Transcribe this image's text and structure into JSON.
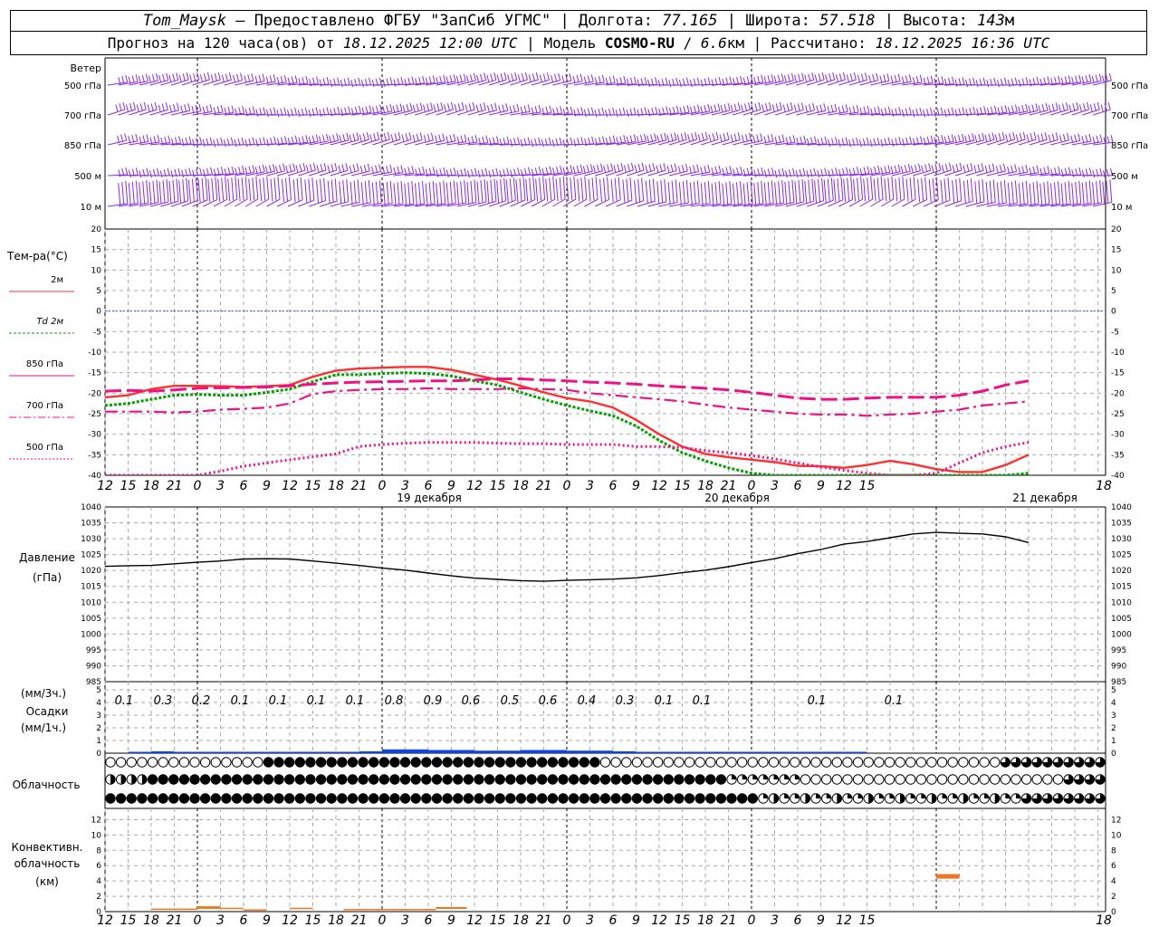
{
  "header": {
    "station": "Tom_Maysk",
    "provider": "– Предоставлено ФГБУ \"ЗапСиб УГМС\"",
    "lon_label": "Долгота:",
    "lon_value": "77.165",
    "lat_label": "Широта:",
    "lat_value": "57.518",
    "alt_label": "Высота:",
    "alt_value": "143",
    "alt_unit": "м",
    "forecast_prefix": "Прогноз на 120 часа(ов) от",
    "forecast_time": "18.12.2025 12:00 UTC",
    "model_label": "Модель",
    "model_name": "COSMO-RU",
    "model_res": "6.6",
    "model_res_unit": "км",
    "calc_label": "Рассчитано:",
    "calc_time": "18.12.2025 16:36 UTC"
  },
  "colors": {
    "wind": "#8a2be2",
    "t2m": "#ff3030",
    "td2m": "#00a000",
    "t850": "#ee1188",
    "zero_line": "#3355ff",
    "pressure": "#000000",
    "precip_bar": "#1144dd",
    "convective": "#ee7722",
    "grid": "#aaaaaa"
  },
  "wind_panel": {
    "title": "Ветер",
    "levels": [
      "500 гПа",
      "700 гПа",
      "850 гПа",
      "500 м",
      "10 м"
    ]
  },
  "temp_panel": {
    "title": "Тем-ра(°C)",
    "legend": [
      {
        "label": "2м",
        "key": "t2m"
      },
      {
        "label": "Td 2м",
        "key": "td2m"
      },
      {
        "label": "850 гПа",
        "key": "t850"
      },
      {
        "label": "700 гПа",
        "key": "t700"
      },
      {
        "label": "500 гПа",
        "key": "t500"
      }
    ],
    "ticks": [
      "20",
      "15",
      "10",
      "5",
      "0",
      "-5",
      "-10",
      "-15",
      "-20",
      "-25",
      "-30",
      "-35",
      "-40"
    ]
  },
  "time_axis": {
    "hour_labels": [
      "12",
      "15",
      "18",
      "21",
      "0",
      "3",
      "6",
      "9",
      "12",
      "15",
      "18",
      "21",
      "0",
      "3",
      "6",
      "9",
      "12",
      "15",
      "18",
      "21",
      "0",
      "3",
      "6",
      "9",
      "12",
      "15",
      "18",
      "21",
      "0",
      "3",
      "6",
      "9",
      "12",
      "15",
      "18"
    ],
    "day_labels": [
      "19 декабря",
      "20 декабря",
      "21 декабря"
    ]
  },
  "pressure_panel": {
    "title": "Давление",
    "unit": "(гПа)",
    "ticks": [
      "1040",
      "1035",
      "1030",
      "1025",
      "1020",
      "1015",
      "1010",
      "1005",
      "1000",
      "995",
      "990",
      "985"
    ]
  },
  "precip_panel": {
    "unit3": "(мм/3ч.)",
    "title": "Осадки",
    "unit1": "(мм/1ч.)",
    "ticks": [
      "5",
      "4",
      "3",
      "2",
      "1",
      "0"
    ],
    "labels": [
      "0.1",
      "0.3",
      "0.2",
      "0.1",
      "0.1",
      "0.1",
      "0.1",
      "0.8",
      "0.9",
      "0.6",
      "0.5",
      "0.6",
      "0.4",
      "0.3",
      "0.1",
      "0.1",
      "0.1",
      "0.1"
    ]
  },
  "cloud_panel": {
    "title": "Облачность"
  },
  "conv_panel": {
    "title_1": "Конвективн.",
    "title_2": "облачность",
    "unit": "(км)",
    "ticks": [
      "12",
      "10",
      "8",
      "6",
      "4",
      "2",
      "0"
    ]
  },
  "chart_data": [
    {
      "type": "line",
      "title": "Тем-ра(°C)",
      "x_hours": [
        0,
        3,
        6,
        9,
        12,
        15,
        18,
        21,
        24,
        27,
        30,
        33,
        36,
        39,
        42,
        45,
        48,
        51,
        54,
        57,
        60,
        63,
        66,
        69,
        72,
        75,
        78,
        81,
        84,
        87,
        90,
        93,
        96,
        99,
        102,
        105,
        108,
        111,
        114,
        117,
        120
      ],
      "ylim": [
        -40,
        20
      ],
      "series": [
        {
          "name": "2м",
          "values": [
            -21,
            -20.5,
            -19,
            -18.2,
            -18.2,
            -18.3,
            -18.5,
            -18.3,
            -18,
            -16,
            -14.5,
            -14,
            -13.8,
            -13.6,
            -13.6,
            -14.3,
            -15.5,
            -16.7,
            -18.2,
            -19.8,
            -21.2,
            -22,
            -23.5,
            -26.5,
            -30,
            -33,
            -34.8,
            -35.6,
            -36.2,
            -36.8,
            -37.7,
            -37.8,
            -38.2,
            -37.5,
            -36.5,
            -37.3,
            -38.5,
            -39.2,
            -39.2,
            -37.5,
            -35
          ]
        },
        {
          "name": "Td 2м",
          "values": [
            -23,
            -22.5,
            -21.5,
            -20.5,
            -20.3,
            -20.5,
            -20.5,
            -19.8,
            -19,
            -17.2,
            -15.5,
            -15.5,
            -15.2,
            -15,
            -15.2,
            -15.8,
            -17,
            -18,
            -19.8,
            -21.5,
            -23,
            -24.3,
            -25.5,
            -28,
            -31.5,
            -34.5,
            -36.5,
            -38.2,
            -39.5,
            -40.5,
            -41.2,
            -41.5,
            -41.7,
            -42,
            -42,
            -42,
            -42,
            -42,
            -42,
            -41.5,
            -39.5
          ]
        },
        {
          "name": "850 гПа",
          "values": [
            -19.5,
            -19.3,
            -19.5,
            -19.2,
            -18.8,
            -18.7,
            -18.6,
            -18.5,
            -18.2,
            -17.8,
            -17.5,
            -17.3,
            -17.2,
            -17.1,
            -17,
            -17,
            -16.8,
            -16.5,
            -16.5,
            -16.8,
            -17,
            -17.3,
            -17.5,
            -17.8,
            -18.2,
            -18.5,
            -18.8,
            -19.2,
            -19.8,
            -20.5,
            -21.2,
            -21.5,
            -21.5,
            -21.2,
            -21,
            -21,
            -21,
            -20.5,
            -19.5,
            -18,
            -17
          ]
        },
        {
          "name": "700 гПа",
          "values": [
            -24.5,
            -24.5,
            -24.5,
            -24.7,
            -24.5,
            -24,
            -23.8,
            -23.5,
            -22.5,
            -20.2,
            -19.5,
            -19.2,
            -19,
            -19,
            -18.8,
            -19,
            -19,
            -19,
            -18.8,
            -19,
            -19.2,
            -20,
            -20.5,
            -21,
            -21.5,
            -22,
            -22.8,
            -23.5,
            -24,
            -24.5,
            -25,
            -25.2,
            -25.2,
            -25.5,
            -25.2,
            -25,
            -24.5,
            -24,
            -23,
            -22.5,
            -22
          ]
        },
        {
          "name": "500 гПа",
          "values": [
            -43,
            -42.5,
            -42,
            -41,
            -40,
            -39,
            -37.8,
            -37,
            -36.2,
            -35.5,
            -34.8,
            -33,
            -32.5,
            -32.2,
            -32,
            -32,
            -32,
            -32.2,
            -32.3,
            -32.3,
            -32.5,
            -32.5,
            -32.5,
            -33,
            -33,
            -33.2,
            -34,
            -34.5,
            -35.2,
            -36,
            -37,
            -38,
            -38.8,
            -39.5,
            -40.2,
            -40.8,
            -39.5,
            -37,
            -34.5,
            -33,
            -32
          ]
        }
      ]
    },
    {
      "type": "line",
      "title": "Давление",
      "ylabel": "(гПа)",
      "x_hours": [
        0,
        3,
        6,
        9,
        12,
        15,
        18,
        21,
        24,
        27,
        30,
        33,
        36,
        39,
        42,
        45,
        48,
        51,
        54,
        57,
        60,
        63,
        66,
        69,
        72,
        75,
        78,
        81,
        84,
        87,
        90,
        93,
        96,
        99,
        102,
        105,
        108,
        111,
        114,
        117,
        120
      ],
      "ylim": [
        985,
        1040
      ],
      "series": [
        {
          "name": "P",
          "values": [
            1021.3,
            1021.5,
            1021.6,
            1022.1,
            1022.6,
            1023,
            1023.6,
            1023.7,
            1023.6,
            1023,
            1022.3,
            1021.6,
            1020.8,
            1020.1,
            1019.2,
            1018.3,
            1017.6,
            1017.2,
            1016.8,
            1016.6,
            1016.9,
            1017.1,
            1017.3,
            1017.7,
            1018.4,
            1019.3,
            1020.1,
            1021.2,
            1022.5,
            1023.7,
            1025.3,
            1026.6,
            1028.3,
            1029.1,
            1030.3,
            1031.5,
            1032,
            1031.7,
            1031.5,
            1030.6,
            1028.8
          ]
        }
      ]
    },
    {
      "type": "bar",
      "title": "Осадки",
      "ylabel": "(мм/1ч.)",
      "x_hours": [
        0,
        3,
        6,
        9,
        12,
        15,
        18,
        21,
        24,
        27,
        30,
        33,
        36,
        39,
        42,
        45,
        48,
        51,
        54,
        57,
        60,
        63,
        66,
        69,
        72,
        75,
        78,
        81,
        84,
        87,
        90,
        93,
        96,
        99,
        102,
        105,
        108,
        111,
        114,
        117
      ],
      "ylim": [
        0,
        5
      ],
      "values": [
        0,
        0.05,
        0.15,
        0.1,
        0.05,
        0.05,
        0.03,
        0.05,
        0.1,
        0.1,
        0.1,
        0.15,
        0.3,
        0.3,
        0.25,
        0.25,
        0.2,
        0.2,
        0.25,
        0.25,
        0.2,
        0.2,
        0.15,
        0.1,
        0.05,
        0.03,
        0.03,
        0.03,
        0.03,
        0.02,
        0.03,
        0.02,
        0.02,
        0,
        0,
        0,
        0,
        0,
        0,
        0
      ]
    },
    {
      "type": "bar",
      "title": "Конвективн. облачность",
      "ylabel": "(км)",
      "ylim": [
        0,
        12
      ],
      "bars": [
        {
          "x_start": 6,
          "x_end": 12,
          "value": 0.4
        },
        {
          "x_start": 12,
          "x_end": 15,
          "value": 0.7
        },
        {
          "x_start": 15,
          "x_end": 18,
          "value": 0.5
        },
        {
          "x_start": 18,
          "x_end": 21,
          "value": 0.3
        },
        {
          "x_start": 24,
          "x_end": 27,
          "value": 0.5
        },
        {
          "x_start": 31,
          "x_end": 43,
          "value": 0.35
        },
        {
          "x_start": 43,
          "x_end": 47,
          "value": 0.6
        },
        {
          "x_start": 108,
          "x_end": 111,
          "value": 4.9
        }
      ]
    }
  ]
}
